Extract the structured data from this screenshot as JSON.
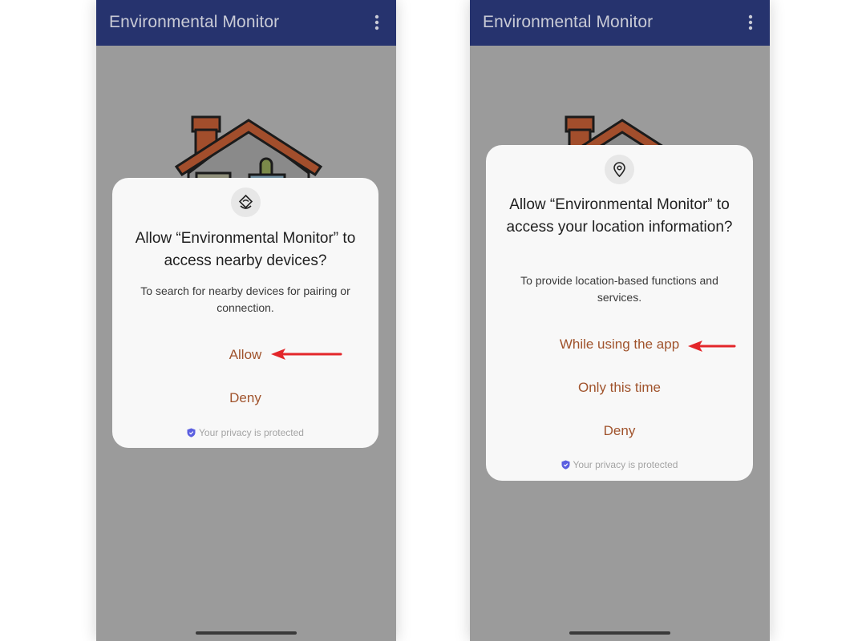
{
  "app": {
    "title": "Environmental Monitor",
    "menu_icon": "more-vert-icon"
  },
  "left_dialog": {
    "icon": "nearby-devices-icon",
    "title": "Allow “Environmental Monitor” to access nearby devices?",
    "description": "To search for nearby devices for pairing or connection.",
    "options": [
      "Allow",
      "Deny"
    ],
    "highlighted_option": "Allow",
    "privacy_text": "Your privacy is protected"
  },
  "right_dialog": {
    "icon": "location-pin-icon",
    "title": "Allow “Environmental Monitor” to access your location information?",
    "description": "To provide location-based functions and services.",
    "options": [
      "While using the app",
      "Only this time",
      "Deny"
    ],
    "highlighted_option": "While using the app",
    "privacy_text": "Your privacy is protected"
  },
  "colors": {
    "appbar": "#26336e",
    "scrim": "#9b9b9b",
    "option_text": "#a0532c",
    "annotation_arrow": "#e3262a",
    "privacy_shield": "#5b5fe0"
  }
}
